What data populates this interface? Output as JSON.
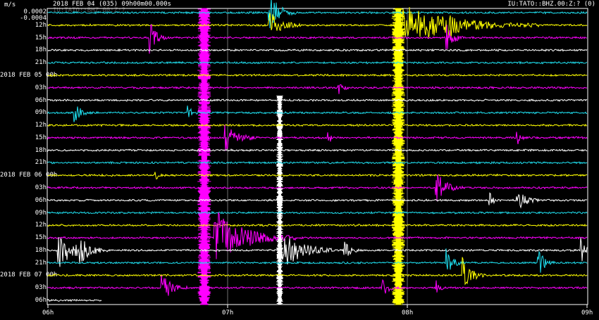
{
  "header": {
    "unit": "m/s",
    "scale_top": "0.0002",
    "scale_bottom": "-0.0004",
    "title": "2018 FEB 04 (035)  09h00m00.000s",
    "station": "IU:TATO::BHZ.00:Z:? (0)",
    "station_overlay": "IU:TATO::BHZ.00:Z:?"
  },
  "colors": {
    "cyan": "#1fe0f0",
    "yellow": "#ffff00",
    "magenta": "#ff00ff",
    "white": "#ffffff",
    "gridline": "#bbbbbb"
  },
  "rows": [
    {
      "label": "",
      "color": "cyan"
    },
    {
      "label": "12h",
      "color": "yellow"
    },
    {
      "label": "15h",
      "color": "magenta"
    },
    {
      "label": "18h",
      "color": "white"
    },
    {
      "label": "21h",
      "color": "cyan"
    },
    {
      "label": "2018 FEB 05  00h",
      "color": "yellow"
    },
    {
      "label": "03h",
      "color": "magenta"
    },
    {
      "label": "06h",
      "color": "white"
    },
    {
      "label": "09h",
      "color": "cyan"
    },
    {
      "label": "12h",
      "color": "yellow"
    },
    {
      "label": "15h",
      "color": "magenta"
    },
    {
      "label": "18h",
      "color": "white"
    },
    {
      "label": "21h",
      "color": "cyan"
    },
    {
      "label": "2018 FEB 06  00h",
      "color": "yellow"
    },
    {
      "label": "03h",
      "color": "magenta"
    },
    {
      "label": "06h",
      "color": "white"
    },
    {
      "label": "09h",
      "color": "cyan"
    },
    {
      "label": "12h",
      "color": "yellow"
    },
    {
      "label": "15h",
      "color": "magenta"
    },
    {
      "label": "18h",
      "color": "white"
    },
    {
      "label": "21h",
      "color": "cyan"
    },
    {
      "label": "2018 FEB 07  00h",
      "color": "yellow"
    },
    {
      "label": "03h",
      "color": "magenta"
    },
    {
      "label": "06h",
      "color": "white"
    }
  ],
  "x_ticks": [
    "06h",
    "07h",
    "08h",
    "09h"
  ],
  "events": [
    {
      "row": 2,
      "t": 0.19,
      "amp": 22,
      "dur": 0.03
    },
    {
      "row": 0,
      "t": 0.41,
      "amp": 30,
      "dur": 0.05
    },
    {
      "row": 1,
      "t": 0.41,
      "amp": 22,
      "dur": 0.06
    },
    {
      "row": 1,
      "t": 0.66,
      "amp": 28,
      "dur": 0.25
    },
    {
      "row": 1,
      "t": 0.74,
      "amp": 26,
      "dur": 0.08
    },
    {
      "row": 2,
      "t": 0.74,
      "amp": 24,
      "dur": 0.03
    },
    {
      "row": 6,
      "t": 0.54,
      "amp": 10,
      "dur": 0.02
    },
    {
      "row": 8,
      "t": 0.05,
      "amp": 16,
      "dur": 0.03
    },
    {
      "row": 8,
      "t": 0.26,
      "amp": 10,
      "dur": 0.02
    },
    {
      "row": 10,
      "t": 0.33,
      "amp": 20,
      "dur": 0.06
    },
    {
      "row": 10,
      "t": 0.52,
      "amp": 10,
      "dur": 0.02
    },
    {
      "row": 10,
      "t": 0.87,
      "amp": 12,
      "dur": 0.02
    },
    {
      "row": 13,
      "t": 0.2,
      "amp": 6,
      "dur": 0.02
    },
    {
      "row": 14,
      "t": 0.72,
      "amp": 24,
      "dur": 0.05
    },
    {
      "row": 15,
      "t": 0.82,
      "amp": 10,
      "dur": 0.02
    },
    {
      "row": 15,
      "t": 0.87,
      "amp": 18,
      "dur": 0.04
    },
    {
      "row": 18,
      "t": 0.31,
      "amp": 40,
      "dur": 0.15
    },
    {
      "row": 19,
      "t": 0.02,
      "amp": 30,
      "dur": 0.08
    },
    {
      "row": 19,
      "t": 0.06,
      "amp": 22,
      "dur": 0.05
    },
    {
      "row": 19,
      "t": 0.43,
      "amp": 32,
      "dur": 0.1
    },
    {
      "row": 19,
      "t": 0.55,
      "amp": 14,
      "dur": 0.03
    },
    {
      "row": 19,
      "t": 0.99,
      "amp": 18,
      "dur": 0.02
    },
    {
      "row": 20,
      "t": 0.74,
      "amp": 20,
      "dur": 0.03
    },
    {
      "row": 20,
      "t": 0.91,
      "amp": 20,
      "dur": 0.03
    },
    {
      "row": 21,
      "t": 0.77,
      "amp": 26,
      "dur": 0.04
    },
    {
      "row": 22,
      "t": 0.21,
      "amp": 24,
      "dur": 0.05
    },
    {
      "row": 22,
      "t": 0.62,
      "amp": 14,
      "dur": 0.03
    },
    {
      "row": 22,
      "t": 0.72,
      "amp": 10,
      "dur": 0.02
    }
  ],
  "bursts": [
    {
      "t": 0.29,
      "color": "magenta",
      "from": 0,
      "to": 23
    },
    {
      "t": 0.65,
      "color": "yellow",
      "from": 0,
      "to": 23
    },
    {
      "t": 0.43,
      "color": "white",
      "from": 7,
      "to": 23
    }
  ]
}
